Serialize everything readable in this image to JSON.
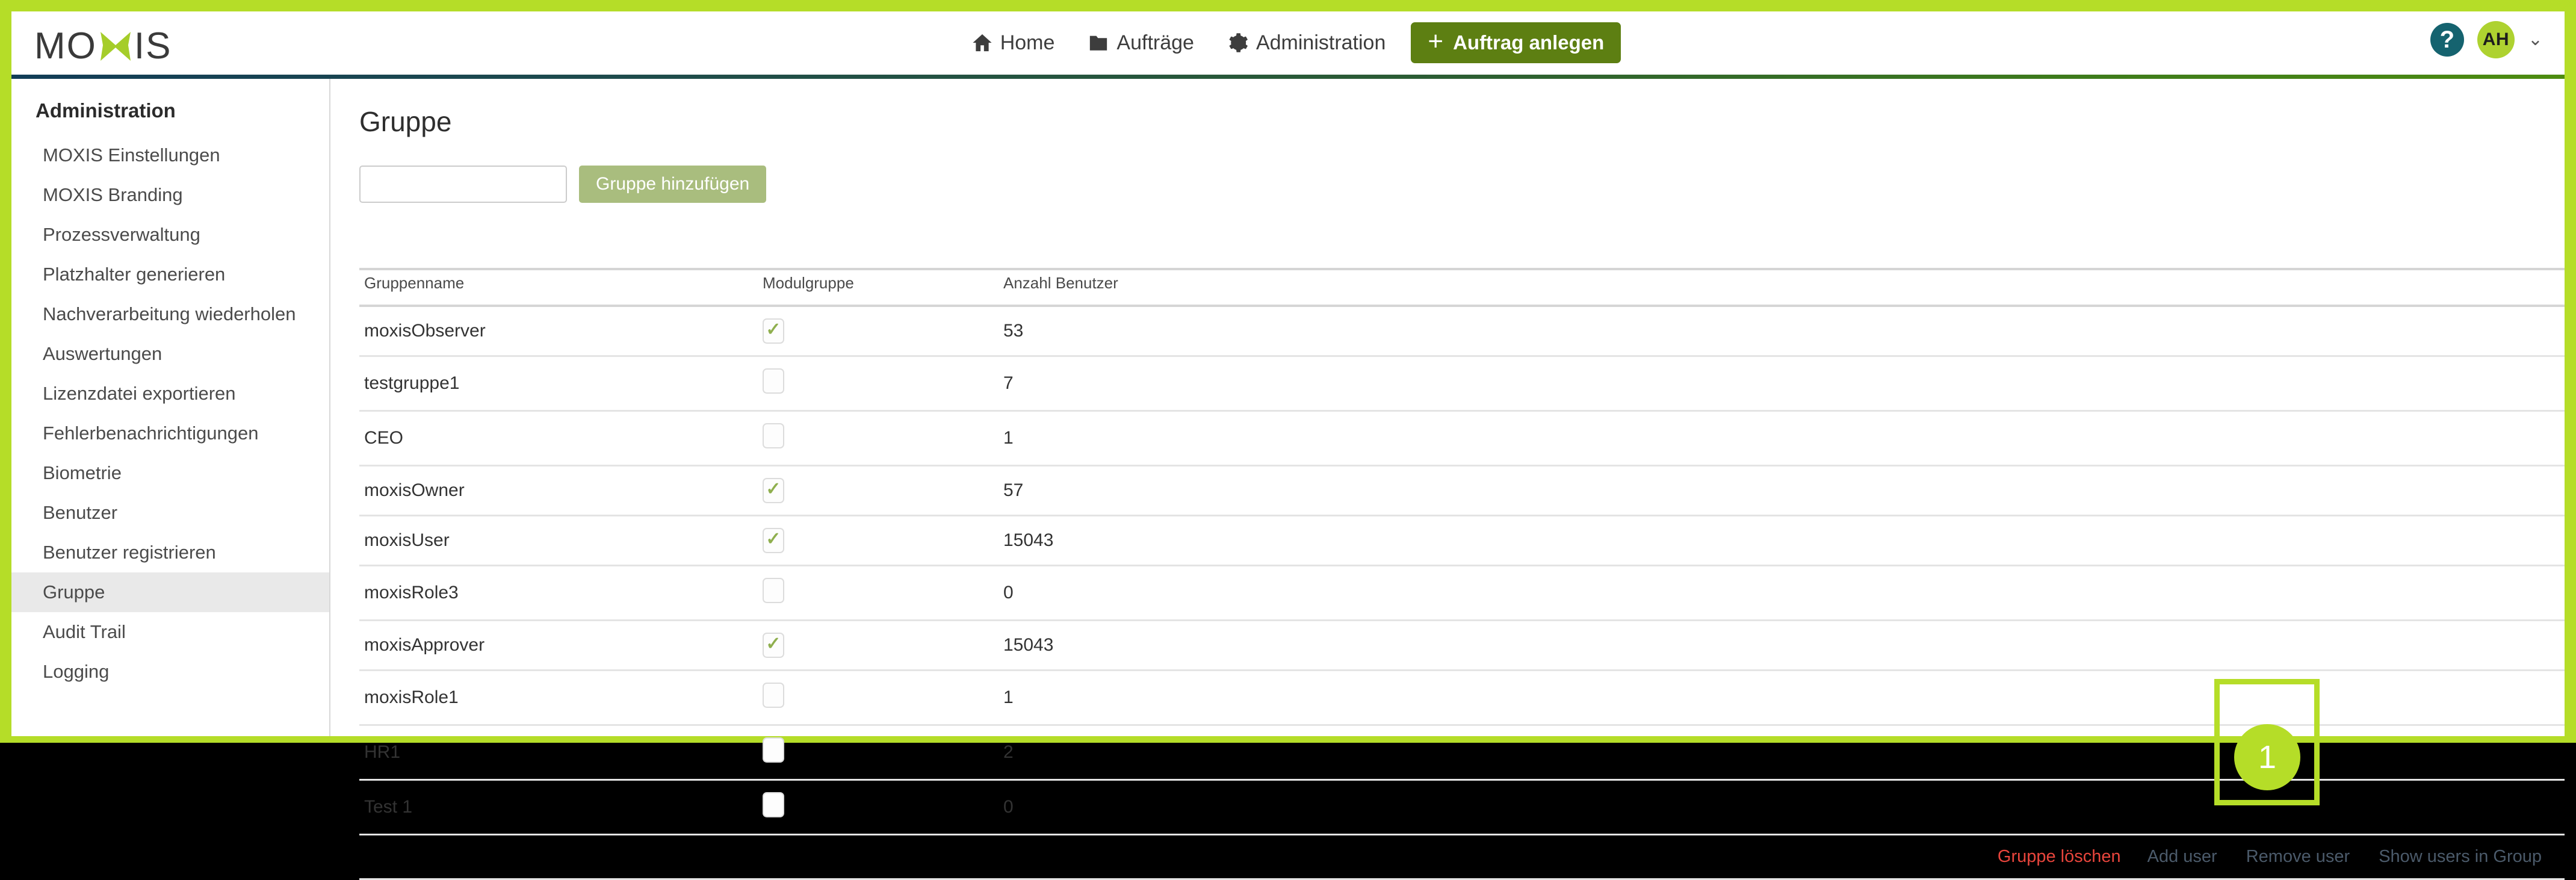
{
  "brand": {
    "logo_text_left": "MO",
    "logo_text_right": "IS",
    "logo_x_icon": "x-mark-icon",
    "accent_green": "#b5dd28",
    "button_green": "#5d7f12",
    "avatar_green": "#aed230",
    "help_teal": "#15636f",
    "danger_red": "#e8453c"
  },
  "header": {
    "nav": [
      {
        "label": "Home",
        "icon": "home-icon"
      },
      {
        "label": "Aufträge",
        "icon": "folder-icon"
      },
      {
        "label": "Administration",
        "icon": "gear-icon"
      }
    ],
    "create_order_label": "Auftrag anlegen",
    "create_order_icon": "plus-icon",
    "help_label": "?",
    "avatar_initials": "AH",
    "avatar_caret_icon": "chevron-down-icon"
  },
  "sidebar": {
    "title": "Administration",
    "items": [
      {
        "label": "MOXIS Einstellungen",
        "active": false
      },
      {
        "label": "MOXIS Branding",
        "active": false
      },
      {
        "label": "Prozessverwaltung",
        "active": false
      },
      {
        "label": "Platzhalter generieren",
        "active": false
      },
      {
        "label": "Nachverarbeitung wiederholen",
        "active": false
      },
      {
        "label": "Auswertungen",
        "active": false
      },
      {
        "label": "Lizenzdatei exportieren",
        "active": false
      },
      {
        "label": "Fehlerbenachrichtigungen",
        "active": false
      },
      {
        "label": "Biometrie",
        "active": false
      },
      {
        "label": "Benutzer",
        "active": false
      },
      {
        "label": "Benutzer registrieren",
        "active": false
      },
      {
        "label": "Gruppe",
        "active": true
      },
      {
        "label": "Audit Trail",
        "active": false
      },
      {
        "label": "Logging",
        "active": false
      }
    ]
  },
  "main": {
    "page_title": "Gruppe",
    "add_form": {
      "input_value": "",
      "input_placeholder": "",
      "button_label": "Gruppe hinzufügen"
    },
    "table": {
      "columns": [
        "Gruppenname",
        "Modulgruppe",
        "Anzahl Benutzer"
      ],
      "rows": [
        {
          "name": "moxisObserver",
          "module": true,
          "count": "53"
        },
        {
          "name": "testgruppe1",
          "module": false,
          "count": "7"
        },
        {
          "name": "CEO",
          "module": false,
          "count": "1"
        },
        {
          "name": "moxisOwner",
          "module": true,
          "count": "57"
        },
        {
          "name": "moxisUser",
          "module": true,
          "count": "15043"
        },
        {
          "name": "moxisRole3",
          "module": false,
          "count": "0"
        },
        {
          "name": "moxisApprover",
          "module": true,
          "count": "15043"
        },
        {
          "name": "moxisRole1",
          "module": false,
          "count": "1"
        },
        {
          "name": "HR1",
          "module": false,
          "count": "2"
        },
        {
          "name": "Test 1",
          "module": false,
          "count": "0"
        }
      ],
      "actions": [
        {
          "label": "Gruppe löschen",
          "style": "danger"
        },
        {
          "label": "Add user",
          "style": "normal"
        },
        {
          "label": "Remove user",
          "style": "normal"
        },
        {
          "label": "Show users in Group",
          "style": "normal"
        }
      ]
    }
  },
  "annotation": {
    "badge_number": "1",
    "target": "Remove user"
  }
}
